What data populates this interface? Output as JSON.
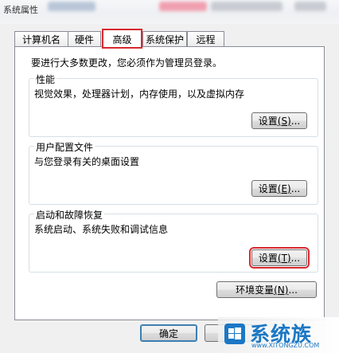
{
  "window": {
    "title": "系统属性"
  },
  "tabs": [
    {
      "label": "计算机名"
    },
    {
      "label": "硬件"
    },
    {
      "label": "高级"
    },
    {
      "label": "系统保护"
    },
    {
      "label": "远程"
    }
  ],
  "notice": "要进行大多数更改，您必须作为管理员登录。",
  "performance": {
    "title": "性能",
    "description": "视觉效果，处理器计划，内存使用，以及虚拟内存",
    "button": {
      "label": "设置",
      "accel": "(S)",
      "ellipsis": "..."
    }
  },
  "user_profiles": {
    "title": "用户配置文件",
    "description": "与您登录有关的桌面设置",
    "button": {
      "label": "设置",
      "accel": "(E)",
      "ellipsis": "..."
    }
  },
  "startup_recovery": {
    "title": "启动和故障恢复",
    "description": "系统启动、系统失败和调试信息",
    "button": {
      "label": "设置",
      "accel": "(T)",
      "ellipsis": "..."
    }
  },
  "env_button": {
    "label": "环境变量",
    "accel": "(N)",
    "ellipsis": "..."
  },
  "footer": {
    "ok_label": "确定"
  },
  "watermark": {
    "text": "系统族",
    "url": "www.XITONGZU.COM"
  },
  "colors": {
    "highlight": "#d8282e",
    "brand": "#1b77c5"
  }
}
